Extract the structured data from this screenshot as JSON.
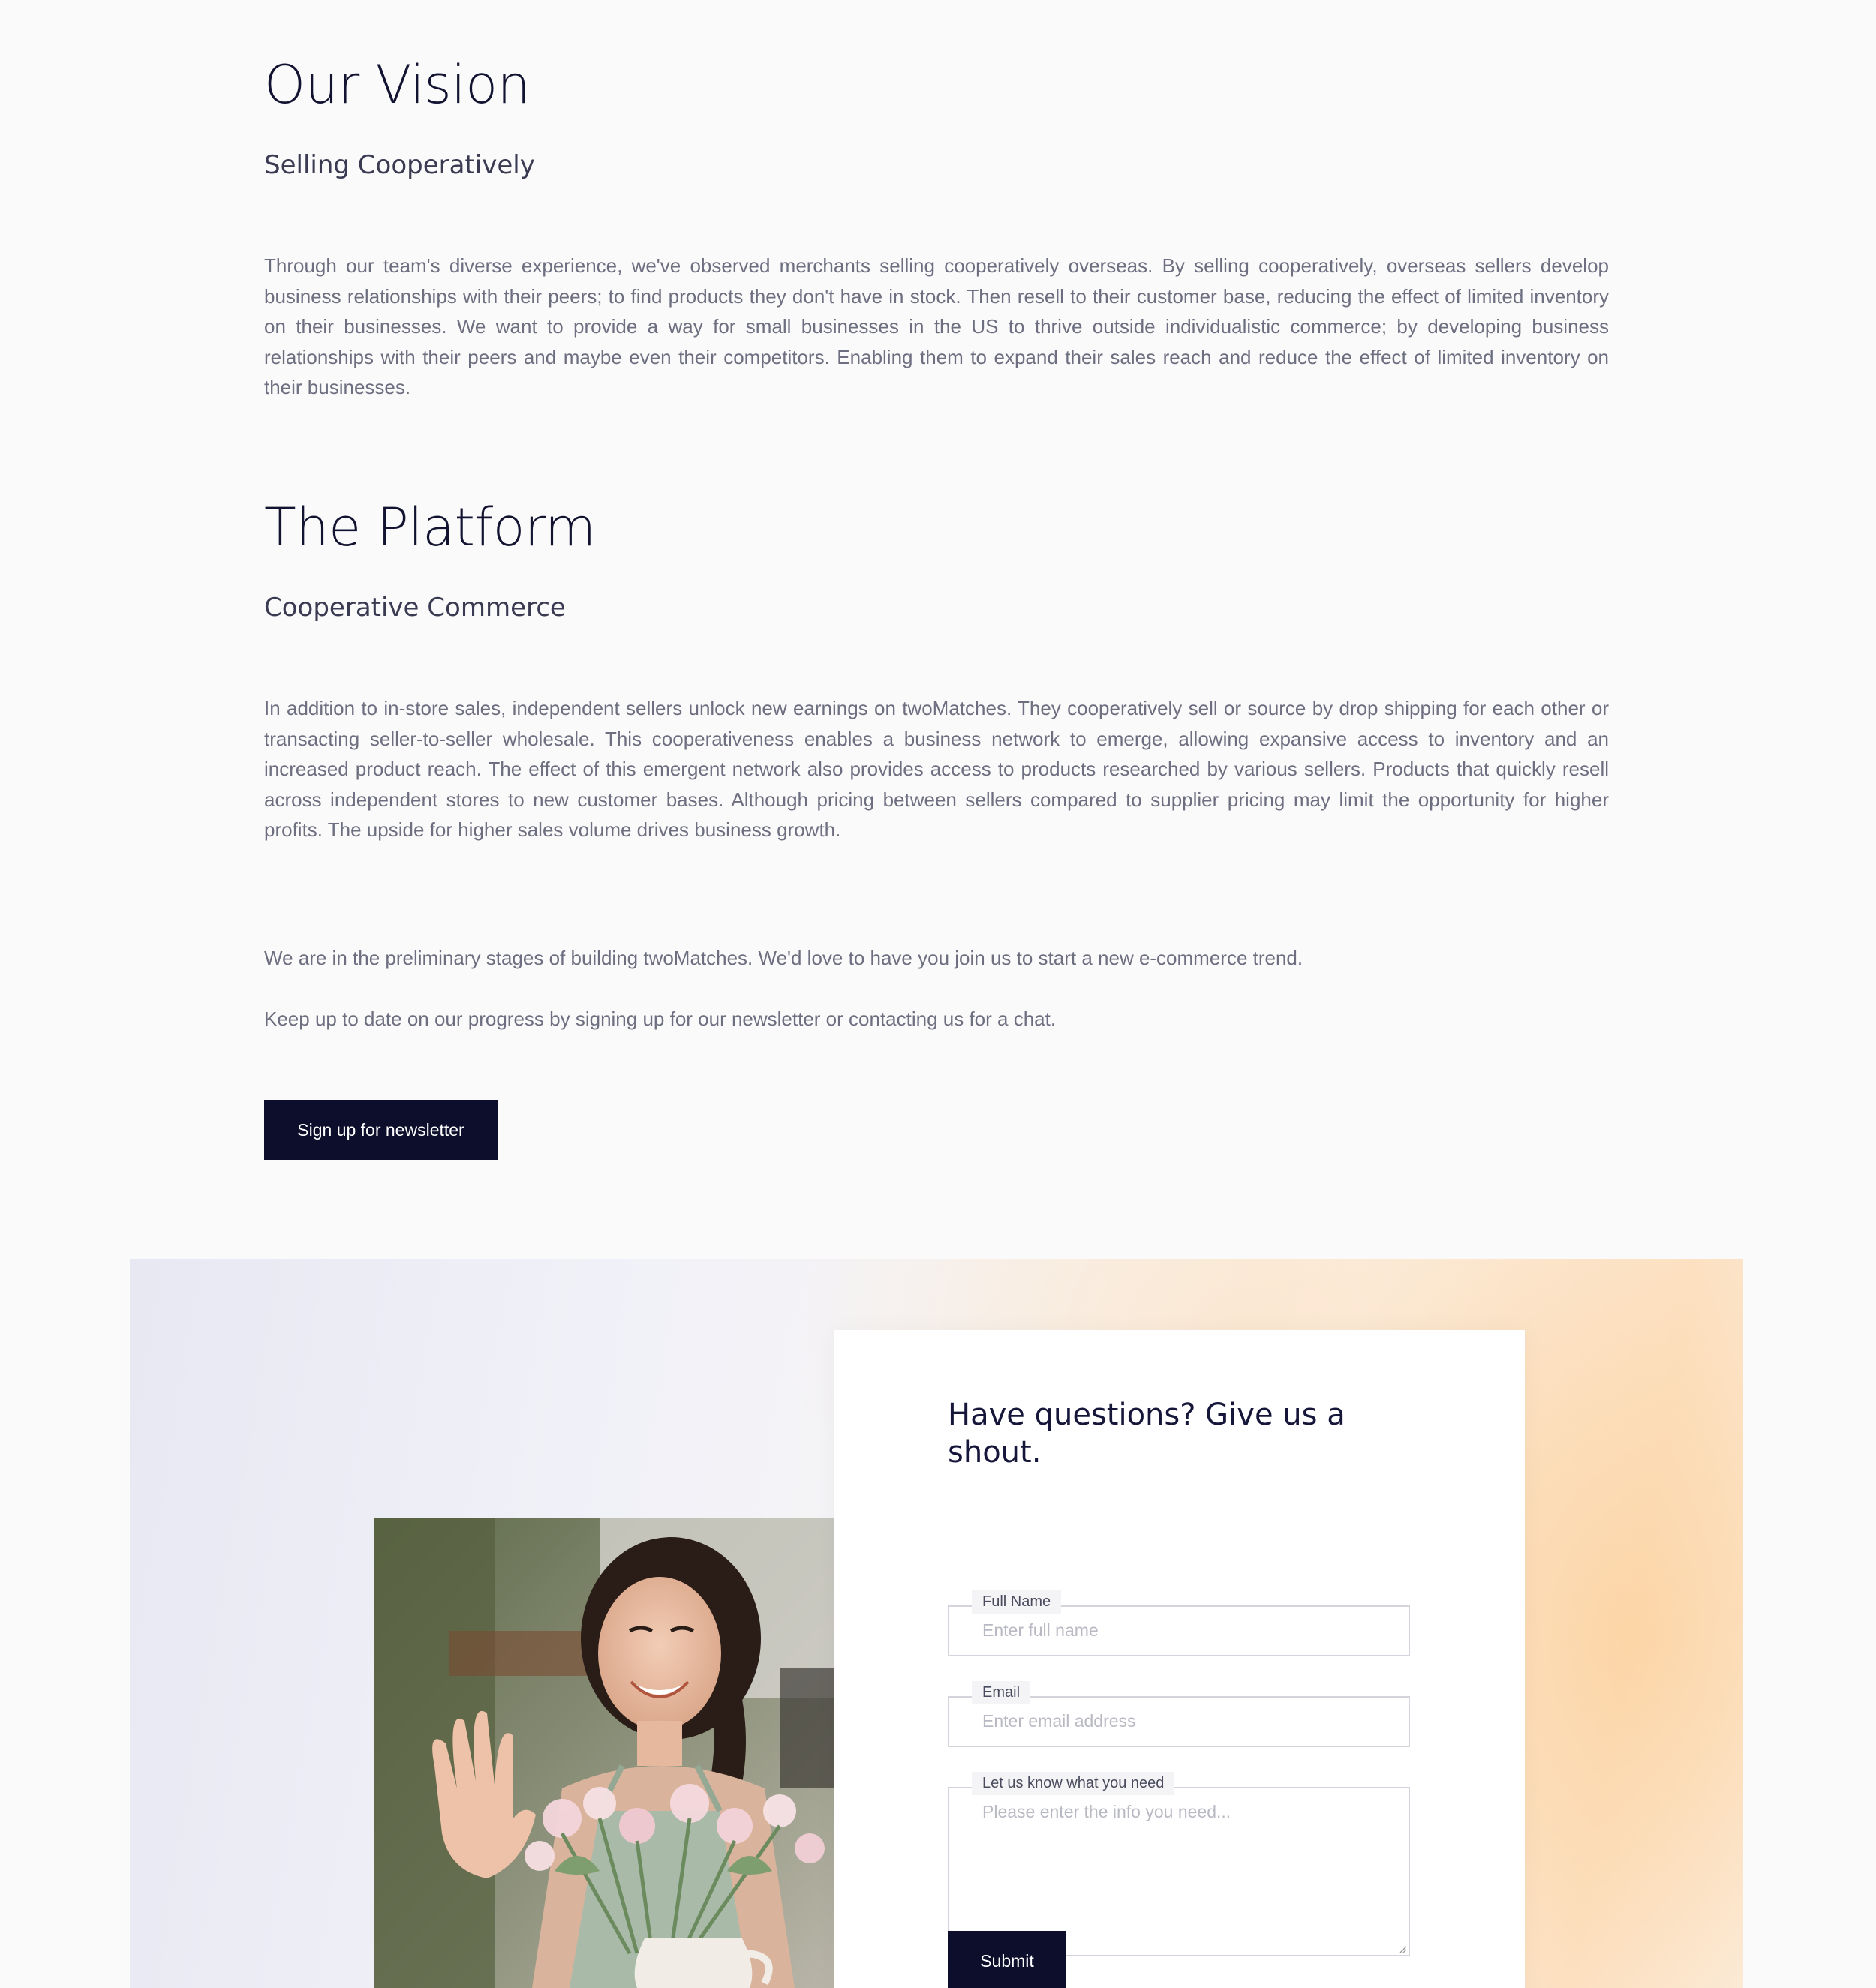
{
  "vision": {
    "heading": "Our Vision",
    "subheading": "Selling Cooperatively",
    "body": "Through our team's diverse experience, we've observed merchants selling cooperatively overseas. By selling cooperatively, overseas sellers develop business relationships with their peers; to find products they don't have in stock. Then resell to their customer base, reducing the effect of limited inventory on their businesses. We want to provide a way for small businesses in the US to thrive outside individualistic commerce; by developing business relationships with their peers and maybe even their competitors. Enabling them to expand their sales reach and reduce the effect of limited inventory on their businesses."
  },
  "platform": {
    "heading": "The Platform",
    "subheading": "Cooperative Commerce",
    "body": "In addition to in-store sales, independent sellers unlock new earnings on twoMatches. They cooperatively sell or source by drop shipping for each other or transacting seller-to-seller wholesale. This cooperativeness enables a business network to emerge, allowing expansive access to inventory and an increased product reach. The effect of this emergent network also provides access to products researched by various sellers. Products that quickly resell across independent stores to new customer bases. Although pricing between sellers compared to supplier pricing may limit the opportunity for higher profits. The upside for higher sales volume drives business growth."
  },
  "closing": {
    "line1": "We are in the preliminary stages of building twoMatches. We'd love to have you join us to start a new e-commerce trend.",
    "line2": "Keep up to date on our progress by signing up for our newsletter or contacting us for a chat.",
    "newsletter_button": "Sign up for newsletter"
  },
  "contact": {
    "title": "Have questions? Give us a shout.",
    "fields": {
      "name": {
        "label": "Full Name",
        "placeholder": "Enter full name"
      },
      "email": {
        "label": "Email",
        "placeholder": "Enter email address"
      },
      "message": {
        "label": "Let us know what you need",
        "placeholder": "Please enter the info you need..."
      }
    },
    "submit_button": "Submit"
  },
  "colors": {
    "page_background": "#fafafa",
    "button_background": "#0d0e2b",
    "heading": "#121331",
    "body_text": "#6d6e80"
  },
  "icons": {
    "photo": "smiling-florist-photo"
  }
}
